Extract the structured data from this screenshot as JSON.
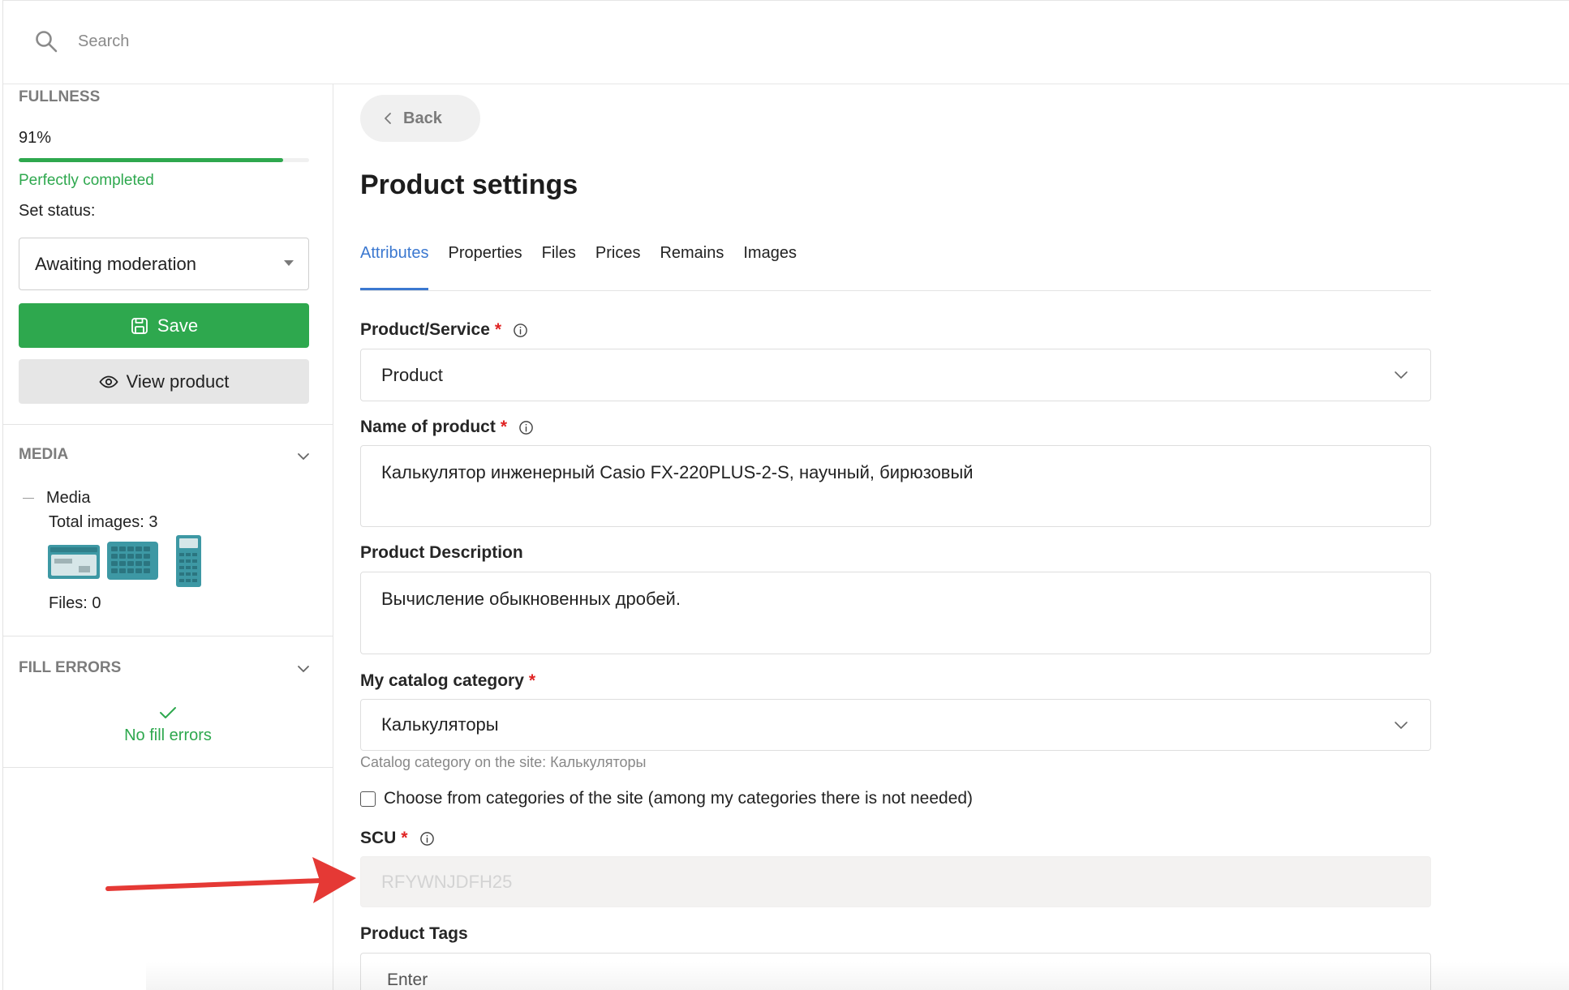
{
  "search": {
    "placeholder": "Search"
  },
  "sidebar": {
    "fullness": {
      "heading": "FULLNESS",
      "percent_text": "91%",
      "progress": 0.91,
      "status_text": "Perfectly completed"
    },
    "status": {
      "label": "Set status:",
      "selected": "Awaiting moderation"
    },
    "actions": {
      "save_label": "Save",
      "view_label": "View product"
    },
    "media": {
      "heading": "MEDIA",
      "tree_label": "Media",
      "total_images": "Total images: 3",
      "files": "Files: 0"
    },
    "fill_errors": {
      "heading": "FILL ERRORS",
      "message": "No fill errors"
    }
  },
  "main": {
    "back_label": "Back",
    "title": "Product settings",
    "tabs": [
      {
        "label": "Attributes",
        "active": true
      },
      {
        "label": "Properties",
        "active": false
      },
      {
        "label": "Files",
        "active": false
      },
      {
        "label": "Prices",
        "active": false
      },
      {
        "label": "Remains",
        "active": false
      },
      {
        "label": "Images",
        "active": false
      }
    ],
    "fields": {
      "product_service": {
        "label": "Product/Service",
        "required_mark": "*",
        "value": "Product"
      },
      "name": {
        "label": "Name of product",
        "required_mark": "*",
        "value": "Калькулятор инженерный Casio FX-220PLUS-2-S, научный, бирюзовый"
      },
      "description": {
        "label": "Product Description",
        "value": "Вычисление обыкновенных дробей."
      },
      "category": {
        "label": "My catalog category",
        "required_mark": "*",
        "value": "Калькуляторы",
        "hint": "Catalog category on the site: Калькуляторы"
      },
      "choose_from_site": {
        "label": "Choose from categories of the site (among my categories there is not needed)",
        "checked": false
      },
      "scu": {
        "label": "SCU",
        "required_mark": "*",
        "value": "RFYWNJDFH25",
        "disabled": true
      },
      "tags": {
        "label": "Product Tags",
        "placeholder": "Enter"
      }
    }
  },
  "icons": {
    "search": "search-icon",
    "save": "save-icon",
    "view": "eye-icon",
    "back": "chevron-left-icon",
    "collapse": "chevron-down-icon",
    "info": "info-icon",
    "success": "check-icon"
  },
  "colors": {
    "accent": "#3b78d0",
    "success": "#2ea84e",
    "required": "#e02424",
    "annotation": "#e53935"
  }
}
